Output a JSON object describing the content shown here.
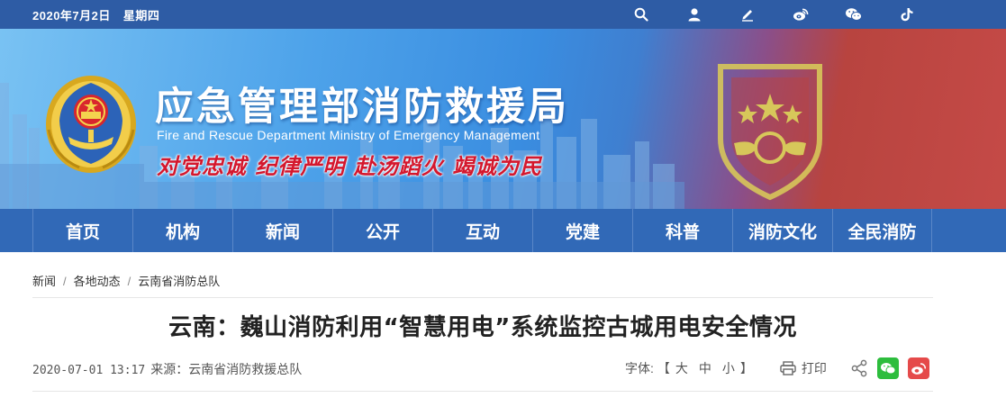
{
  "topbar": {
    "date": "2020年7月2日",
    "weekday": "星期四",
    "icons": [
      "search-icon",
      "user-icon",
      "edit-icon",
      "weibo-icon",
      "wechat-icon",
      "tiktok-icon"
    ]
  },
  "banner": {
    "title": "应急管理部消防救援局",
    "subtitle": "Fire and Rescue Department Ministry of Emergency Management",
    "slogan": "对党忠诚 纪律严明 赴汤蹈火 竭诚为民"
  },
  "nav": {
    "items": [
      "首页",
      "机构",
      "新闻",
      "公开",
      "互动",
      "党建",
      "科普",
      "消防文化",
      "全民消防"
    ]
  },
  "breadcrumb": {
    "items": [
      "新闻",
      "各地动态",
      "云南省消防总队"
    ],
    "separator": "/"
  },
  "article": {
    "title": "云南：巍山消防利用“智慧用电”系统监控古城用电安全情况",
    "time": "2020-07-01 13:17",
    "source": "来源：云南省消防救援总队"
  },
  "tools": {
    "font_label": "字体:",
    "bracket_open": "【",
    "sizes": [
      "大",
      "中",
      "小"
    ],
    "bracket_close": "】",
    "print_label": "打印"
  },
  "colors": {
    "topbar": "#2e5ca5",
    "nav": "#3169b7",
    "slogan": "#d4172d",
    "wechat": "#2dbd3d",
    "weibo": "#e54a4a"
  }
}
